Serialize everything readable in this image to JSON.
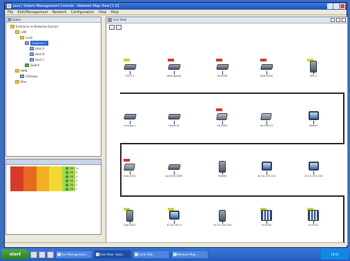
{
  "window": {
    "title": "Java / Solaris Management Console - Network Map View  [1.0]"
  },
  "menu": [
    "File",
    "Edit/Management",
    "Network",
    "Configuration",
    "View",
    "Help"
  ],
  "tree_panel": {
    "header": "Global",
    "nodes": [
      {
        "label": "Enterprise & Networks Domain",
        "icon": "folder",
        "level": 0,
        "selected": false
      },
      {
        "label": "LAN",
        "icon": "folder",
        "level": 1,
        "selected": false
      },
      {
        "label": "Local",
        "icon": "folder",
        "level": 2,
        "selected": false
      },
      {
        "label": "Segment 1",
        "icon": "pc",
        "level": 3,
        "selected": true
      },
      {
        "label": "Host A",
        "icon": "pc",
        "level": 4,
        "selected": false
      },
      {
        "label": "Host B",
        "icon": "pc",
        "level": 4,
        "selected": false
      },
      {
        "label": "Host C",
        "icon": "pc",
        "level": 4,
        "selected": false
      },
      {
        "label": "Switch",
        "icon": "green",
        "level": 3,
        "selected": false
      },
      {
        "label": "WAN",
        "icon": "folder",
        "level": 1,
        "selected": false
      },
      {
        "label": "Gateway",
        "icon": "pc",
        "level": 2,
        "selected": false
      },
      {
        "label": "Misc",
        "icon": "folder",
        "level": 1,
        "selected": false
      }
    ]
  },
  "status_panel": {
    "colors": [
      "#d83c28",
      "#e86a20",
      "#f0b020",
      "#f2d830",
      "#a8d850"
    ],
    "rows": [
      "OK - 12",
      "OK - 8",
      "OK - 5",
      "OK - 3",
      "OK - 2",
      "OK - 1"
    ]
  },
  "map_panel": {
    "header": "Icon View",
    "devices": [
      {
        "label": "192.0.1",
        "type": "router",
        "flag": "yellow"
      },
      {
        "label": "Host-ipppt4",
        "type": "router",
        "flag": "red"
      },
      {
        "label": "fw-0000",
        "type": "router",
        "flag": "red"
      },
      {
        "label": "Host-0000",
        "type": "router",
        "flag": "red"
      },
      {
        "label": "SRV-1",
        "type": "server",
        "flag": "yellow"
      },
      {
        "label": "vms-gw-1",
        "type": "router",
        "flag": "none"
      },
      {
        "label": "hostA-ID",
        "type": "router",
        "flag": "none"
      },
      {
        "label": "hp-0000",
        "type": "hub",
        "flag": "red"
      },
      {
        "label": "hp-0000-0",
        "type": "hub",
        "flag": "none"
      },
      {
        "label": "NodeH",
        "type": "workstation",
        "flag": "none"
      },
      {
        "label": "host-0001",
        "type": "hub",
        "flag": "red"
      },
      {
        "label": "sp-0000-0000",
        "type": "router",
        "flag": "none"
      },
      {
        "label": "Hostfw",
        "type": "server",
        "flag": "none"
      },
      {
        "label": "10.10.100.103",
        "type": "workstation",
        "flag": "none"
      },
      {
        "label": "10.10.100.104",
        "type": "workstation",
        "flag": "none"
      },
      {
        "label": "mgt-0001",
        "type": "server",
        "flag": "yellow"
      },
      {
        "label": "10.10.100.5",
        "type": "workstation",
        "flag": "yellow"
      },
      {
        "label": "10.10.100.105",
        "type": "server",
        "flag": "none"
      },
      {
        "label": "Qr-0000",
        "type": "qr",
        "flag": "yellow"
      },
      {
        "label": "Qr-0001",
        "type": "qr",
        "flag": "yellow"
      }
    ]
  },
  "taskbar": {
    "start": "start",
    "items": [
      {
        "label": "Sun Management...",
        "active": false
      },
      {
        "label": "Icon View - Java...",
        "active": true
      },
      {
        "label": "Local Disk...",
        "active": false
      },
      {
        "label": "Network Map...",
        "active": false
      }
    ],
    "clock": "10:52"
  }
}
